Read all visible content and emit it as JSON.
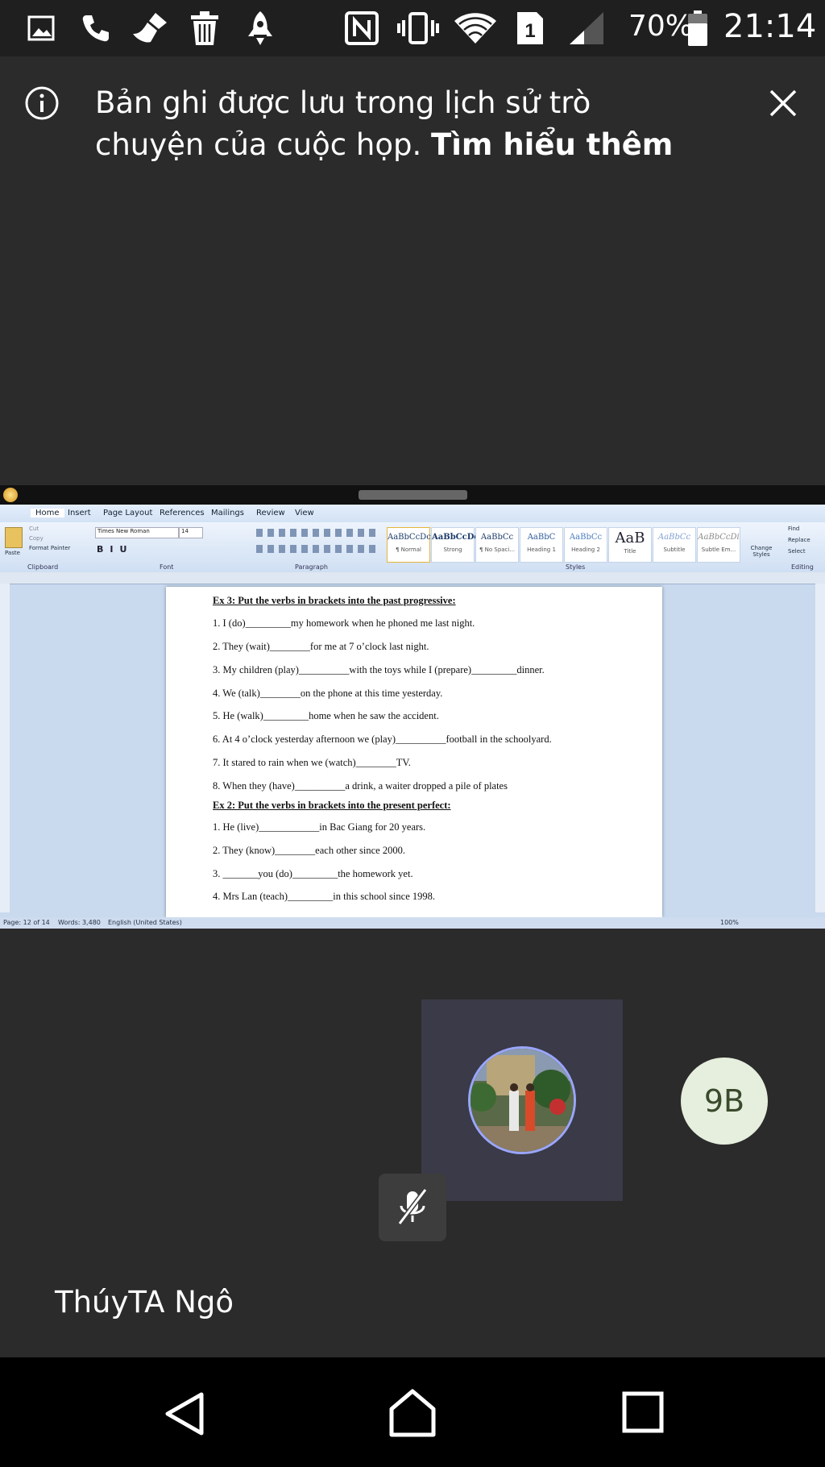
{
  "status_bar": {
    "icons": [
      "gallery-icon",
      "phone-icon",
      "broom-icon",
      "trash-icon",
      "rocket-icon",
      "nfc-icon",
      "vibrate-icon",
      "wifi-icon",
      "sim-1-icon",
      "signal-icon",
      "battery-icon"
    ],
    "battery": "70%",
    "time": "21:14"
  },
  "banner": {
    "message": "Bản ghi được lưu trong lịch sử trò chuyện của cuộc họp.",
    "link": "Tìm hiểu thêm"
  },
  "shared_screen": {
    "ribbon_tabs": [
      "Home",
      "Insert",
      "Page Layout",
      "References",
      "Mailings",
      "Review",
      "View"
    ],
    "font_name": "Times New Roman",
    "font_size": "14",
    "clipboard": {
      "paste": "Paste",
      "cut": "Cut",
      "copy": "Copy",
      "format_painter": "Format Painter"
    },
    "group_labels": [
      "Clipboard",
      "Font",
      "Paragraph",
      "Styles",
      "Editing"
    ],
    "styles": [
      {
        "sample": "AaBbCcDc",
        "name": "¶ Normal"
      },
      {
        "sample": "AaBbCcDc",
        "name": "Strong"
      },
      {
        "sample": "AaBbCc",
        "name": "¶ No Spaci..."
      },
      {
        "sample": "AaBbC",
        "name": "Heading 1"
      },
      {
        "sample": "AaBbCc",
        "name": "Heading 2"
      },
      {
        "sample": "AaB",
        "name": "Title"
      },
      {
        "sample": "AaBbCc",
        "name": "Subtitle"
      },
      {
        "sample": "AaBbCcDi",
        "name": "Subtle Em..."
      }
    ],
    "change_styles": "Change Styles",
    "editing": [
      "Find",
      "Replace",
      "Select"
    ],
    "document_lines": [
      {
        "text": "Ex 3: Put the verbs in brackets into the past progressive:",
        "heading": true
      },
      {
        "text": "1. I (do)_________my homework when he phoned me last night.",
        "heading": false
      },
      {
        "text": "2. They (wait)________for me at 7 o’clock last night.",
        "heading": false
      },
      {
        "text": "3. My children (play)__________with the toys while I (prepare)_________dinner.",
        "heading": false
      },
      {
        "text": "4. We (talk)________on the phone at this time yesterday.",
        "heading": false
      },
      {
        "text": "5. He (walk)_________home when he saw the accident.",
        "heading": false
      },
      {
        "text": "6. At 4 o’clock yesterday afternoon we (play)__________football in the schoolyard.",
        "heading": false
      },
      {
        "text": "7. It stared to rain when we (watch)________TV.",
        "heading": false
      },
      {
        "text": "8. When they (have)__________a drink, a waiter dropped a pile of plates",
        "heading": false
      },
      {
        "text": "Ex 2:  Put the verbs in brackets into the present perfect:",
        "heading": true
      },
      {
        "text": "1. He (live)____________in Bac Giang for 20 years.",
        "heading": false
      },
      {
        "text": "2. They (know)________each other since 2000.",
        "heading": false
      },
      {
        "text": "3. _______you (do)_________the homework yet.",
        "heading": false
      },
      {
        "text": "4. Mrs Lan (teach)_________in this school since 1998.",
        "heading": false
      }
    ],
    "status": {
      "page": "Page: 12 of 14",
      "words": "Words: 3,480",
      "language": "English (United States)",
      "zoom": "100%"
    }
  },
  "participants": {
    "badge_initials": "9B",
    "name": "ThúyTA Ngô"
  },
  "colors": {
    "background": "#2b2b2b",
    "avatar_ring": "#9aa6ff",
    "badge_bg": "#e6efdd",
    "tile_bg": "#3a3a48"
  }
}
